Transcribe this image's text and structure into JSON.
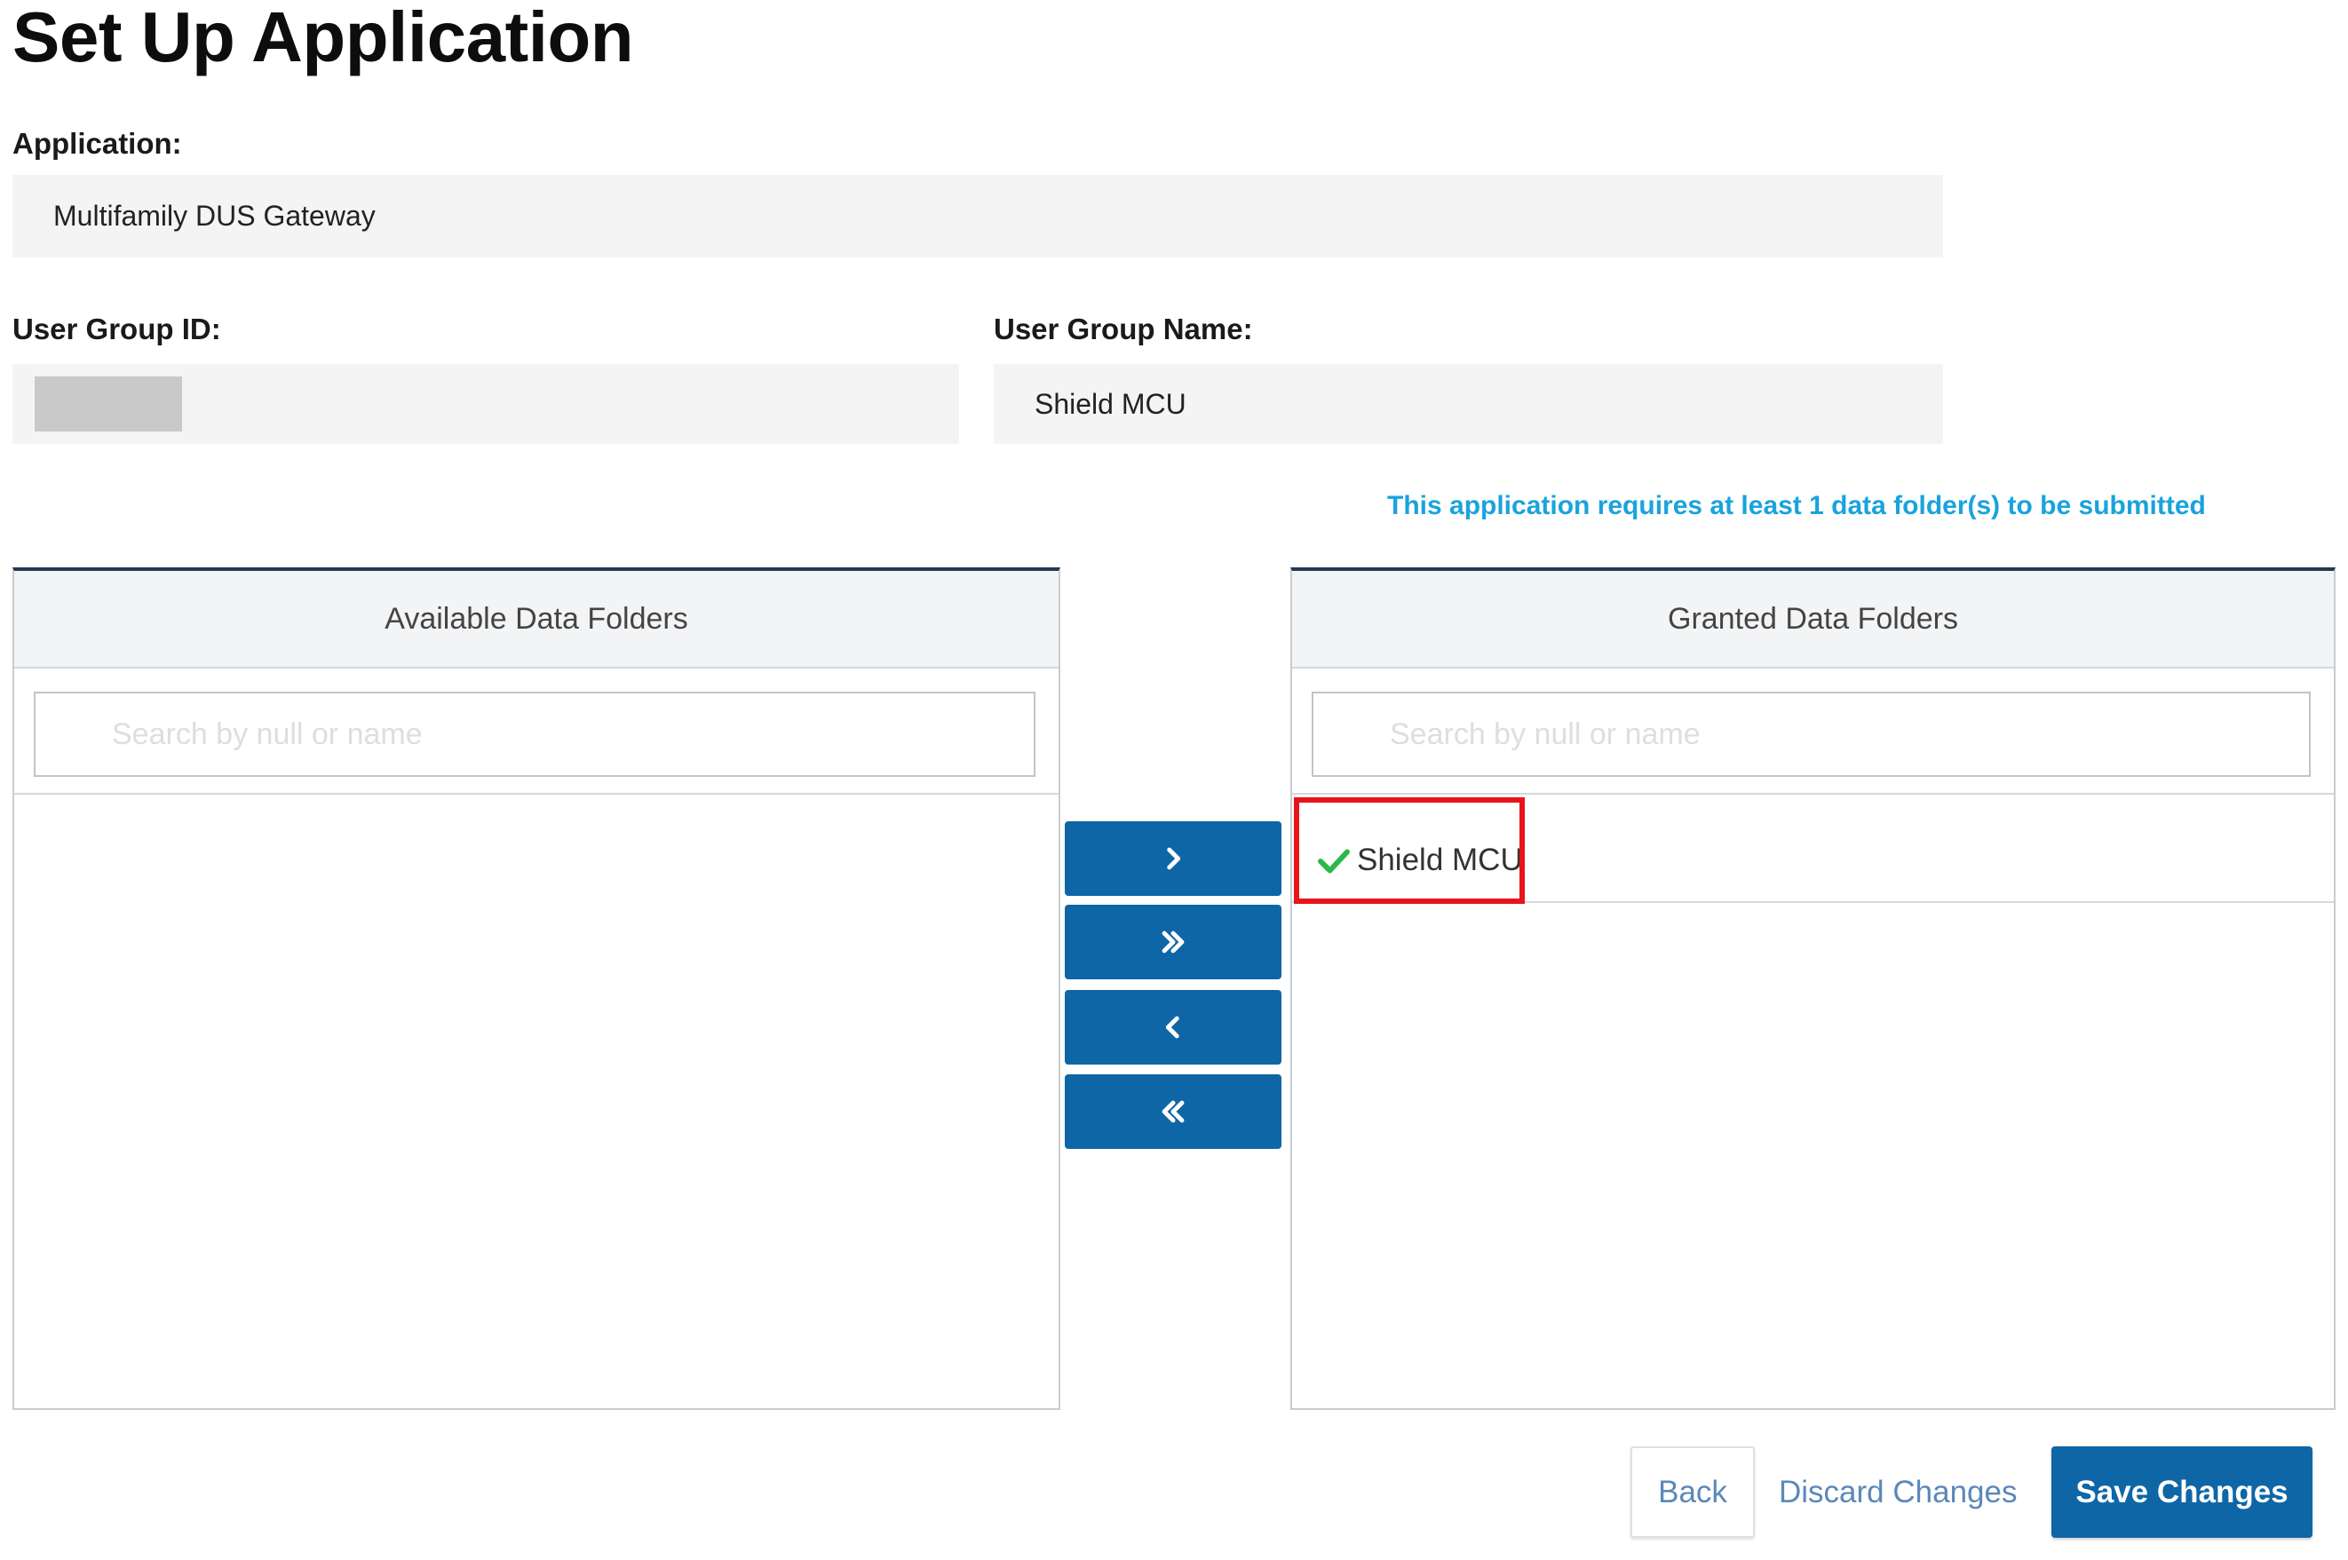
{
  "page": {
    "title": "Set Up Application"
  },
  "application": {
    "label": "Application:",
    "value": "Multifamily DUS Gateway"
  },
  "user_group_id": {
    "label": "User Group ID:"
  },
  "user_group_name": {
    "label": "User Group Name:",
    "value": "Shield MCU"
  },
  "requirement_message": "This application requires at least 1 data folder(s) to be submitted",
  "available_panel": {
    "header": "Available Data Folders",
    "search_placeholder": "Search by null or name",
    "items": []
  },
  "granted_panel": {
    "header": "Granted Data Folders",
    "search_placeholder": "Search by null or name",
    "items": [
      {
        "label": "Shield MCU",
        "icon": "checkmark-icon"
      }
    ]
  },
  "transfer_buttons": {
    "move_selected_right": "chevron-right-icon",
    "move_all_right": "double-chevron-right-icon",
    "move_selected_left": "chevron-left-icon",
    "move_all_left": "double-chevron-left-icon"
  },
  "footer": {
    "back_label": "Back",
    "discard_label": "Discard Changes",
    "save_label": "Save Changes"
  },
  "colors": {
    "primary": "#0e66a6",
    "link": "#5b88b8",
    "info": "#1aa3dc",
    "highlight": "#e8141a",
    "check": "#2db84a",
    "panel_top_border": "#243a52"
  }
}
